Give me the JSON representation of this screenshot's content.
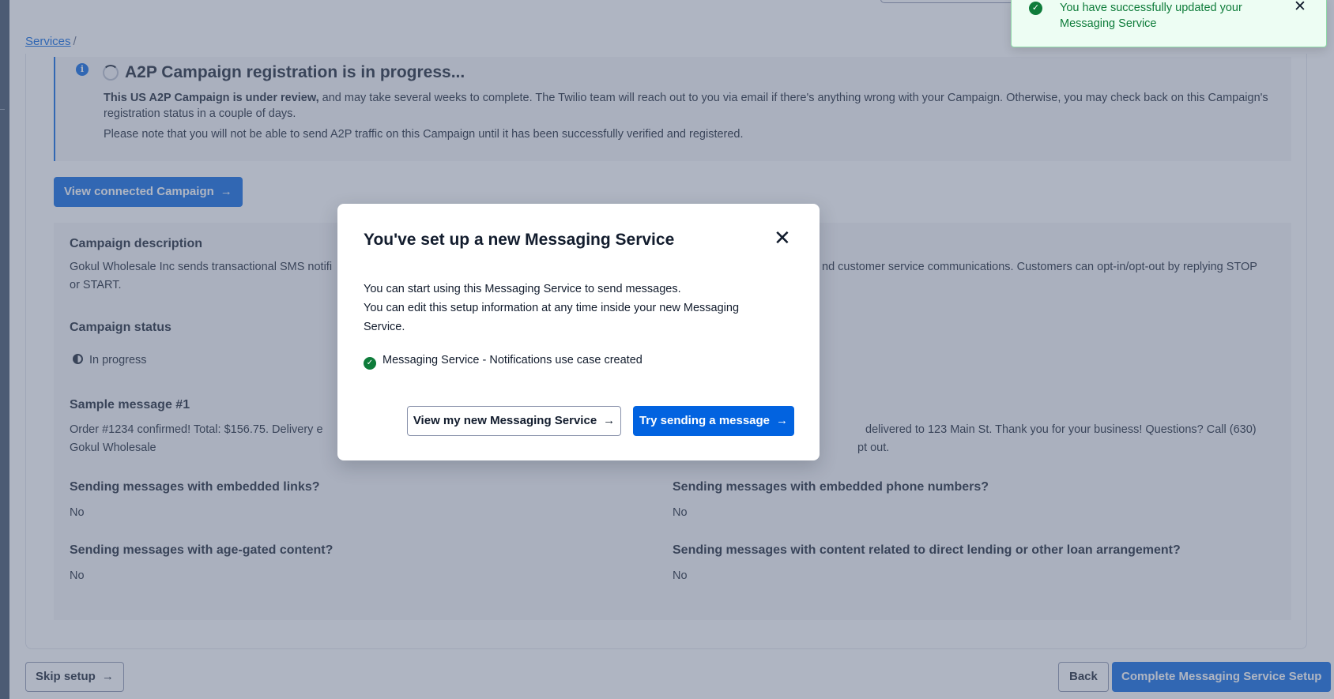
{
  "breadcrumb": {
    "services_link": "Services",
    "separator": "/"
  },
  "callout": {
    "title": "A2P Campaign registration is in progress...",
    "bold_lead": "This US A2P Campaign is under review,",
    "body_1": " and may take several weeks to complete. The Twilio team will reach out to you via email if there's anything wrong with your Campaign. Otherwise, you may check back on this Campaign's registration status in a couple of days.",
    "body_2": "Please note that you will not be able to send A2P traffic on this Campaign until it has been successfully verified and registered."
  },
  "view_campaign_button": "View connected Campaign",
  "details": {
    "campaign_description_label": "Campaign description",
    "campaign_description_left": "Gokul Wholesale Inc sends transactional SMS notifi",
    "campaign_description_right": "nd customer service communications. Customers can opt-in/opt-out by replying STOP",
    "campaign_description_wrap": "or START.",
    "campaign_status_label": "Campaign status",
    "campaign_status_value": "In progress",
    "sample_message_label": "Sample message #1",
    "sample_message_left": "Order #1234 confirmed! Total: $156.75. Delivery e",
    "sample_message_right": "delivered to 123 Main St. Thank you for your business! Questions? Call (630)",
    "sample_message_wrap_left": "Gokul Wholesale",
    "sample_message_wrap_right": "pt out.",
    "embedded_links_label": "Sending messages with embedded links?",
    "embedded_links_value": "No",
    "embedded_phone_label": "Sending messages with embedded phone numbers?",
    "embedded_phone_value": "No",
    "age_gated_label": "Sending messages with age-gated content?",
    "age_gated_value": "No",
    "direct_lending_label": "Sending messages with content related to direct lending or other loan arrangement?",
    "direct_lending_value": "No"
  },
  "footer": {
    "skip_label": "Skip setup",
    "back_label": "Back",
    "complete_label": "Complete Messaging Service Setup"
  },
  "toast": {
    "message": "You have successfully updated your Messaging Service"
  },
  "modal": {
    "title": "You've set up a new Messaging Service",
    "line_1": "You can start using this Messaging Service to send messages.",
    "line_2": "You can edit this setup information at any time inside your new Messaging Service.",
    "created_item": "Messaging Service - Notifications use case created",
    "secondary_button": "View my new Messaging Service",
    "primary_button": "Try sending a message"
  },
  "icons": {
    "arrow": "arrow-right-icon",
    "close": "close-icon",
    "check": "check-circle-icon",
    "info": "info-icon",
    "spinner": "spinner-icon",
    "status": "half-filled-circle-icon"
  },
  "colors": {
    "primary": "#0263e0",
    "success": "#0e7c3a",
    "toast_bg": "#edfdf3",
    "panel_bg": "#f4f4f6",
    "sidebar": "#384a63"
  }
}
